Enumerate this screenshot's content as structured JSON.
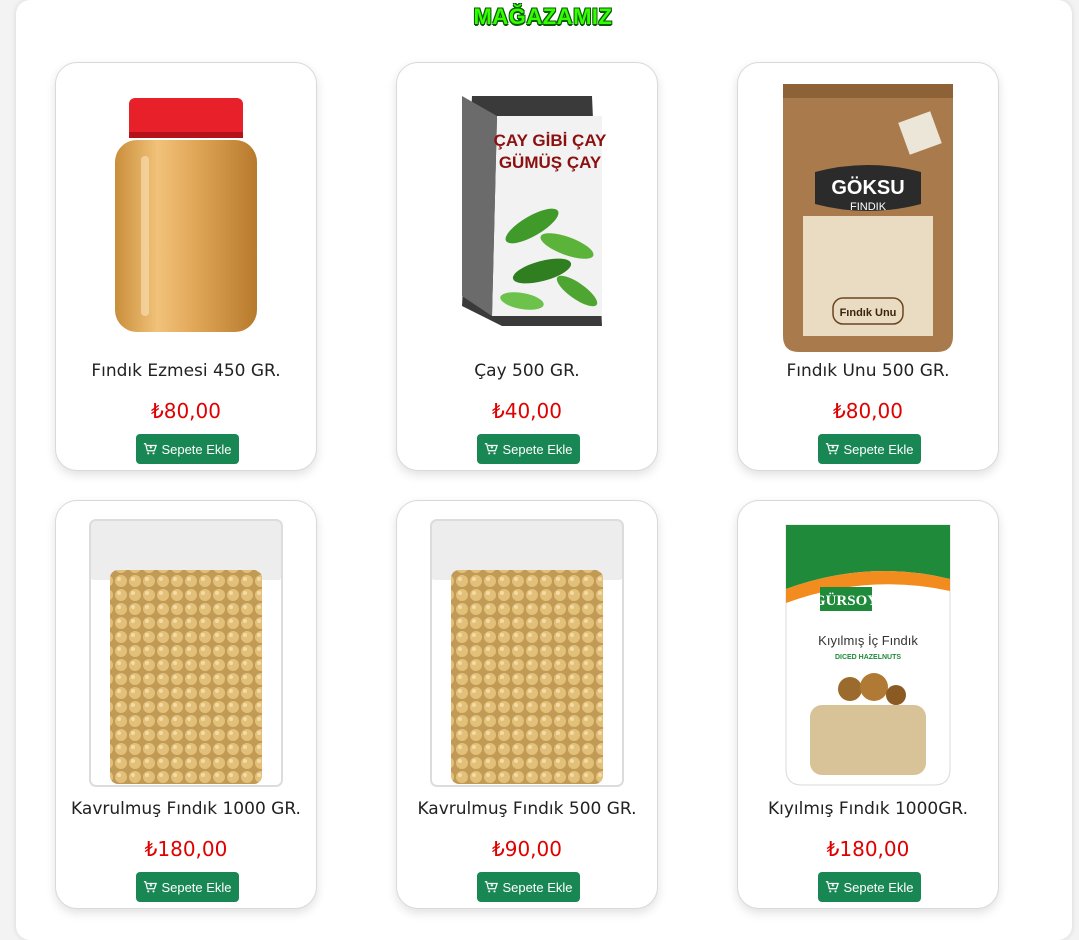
{
  "store": {
    "title": "MAĞAZAMIZ"
  },
  "colors": {
    "title": "#33ff00",
    "price": "#e00000",
    "button": "#198754"
  },
  "products": [
    {
      "name": "Fındık Ezmesi 450 GR.",
      "price": "₺80,00",
      "button_label": "Sepete Ekle",
      "button_icon": "cart-plus-icon",
      "image": "peanut-butter-jar"
    },
    {
      "name": "Çay 500 GR.",
      "price": "₺40,00",
      "button_label": "Sepete Ekle",
      "button_icon": "cart-plus-icon",
      "image": "tea-bag-package",
      "image_text": [
        "ÇAY GİBİ ÇAY",
        "GÜMÜŞ ÇAY"
      ]
    },
    {
      "name": "Fındık Unu 500 GR.",
      "price": "₺80,00",
      "button_label": "Sepete Ekle",
      "button_icon": "cart-plus-icon",
      "image": "kraft-pouch",
      "image_text": [
        "GÖKSU",
        "FINDIK",
        "Fındık Unu"
      ]
    },
    {
      "name": "Kavrulmuş Fındık 1000 GR.",
      "price": "₺180,00",
      "button_label": "Sepete Ekle",
      "button_icon": "cart-plus-icon",
      "image": "vacuum-pack-hazelnuts"
    },
    {
      "name": "Kavrulmuş Fındık 500 GR.",
      "price": "₺90,00",
      "button_label": "Sepete Ekle",
      "button_icon": "cart-plus-icon",
      "image": "vacuum-pack-hazelnuts"
    },
    {
      "name": "Kıyılmış Fındık 1000GR.",
      "price": "₺180,00",
      "button_label": "Sepete Ekle",
      "button_icon": "cart-plus-icon",
      "image": "green-pouch",
      "image_text": [
        "GÜRSOY",
        "Kıyılmış İç Fındık",
        "DICED HAZELNUTS"
      ]
    }
  ]
}
